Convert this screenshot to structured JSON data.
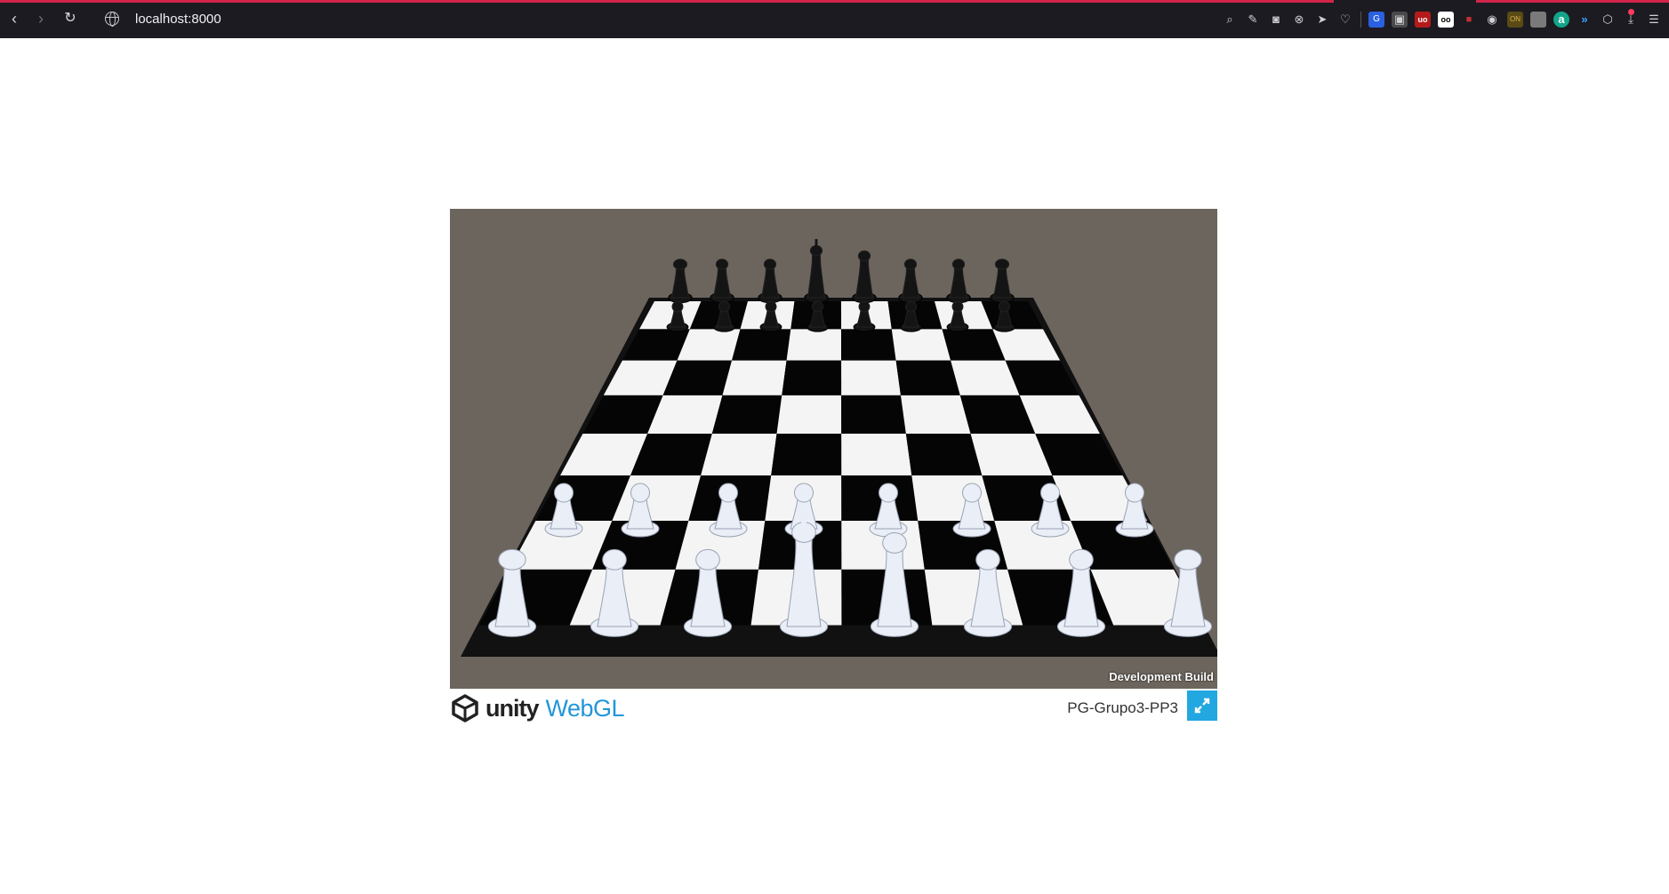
{
  "browser": {
    "url": "localhost:8000",
    "toolbar_icons": [
      "zoom-icon",
      "edit-icon",
      "camera-icon",
      "block-icon",
      "send-icon",
      "heart-icon",
      "translate-icon",
      "cube-icon",
      "ublock-icon",
      "glasses-icon",
      "video-icon",
      "eye-icon",
      "ext-icon",
      "square-icon",
      "amazon-icon",
      "wave-icon",
      "box-icon",
      "download-icon",
      "sidebar-icon"
    ]
  },
  "game": {
    "development_build": "Development Build",
    "product_title": "PG-Grupo3-PP3"
  },
  "logo": {
    "unity": "unity",
    "webgl": "WebGL"
  },
  "colors": {
    "canvas_bg": "#6c655d",
    "accent": "#22a7e0",
    "chrome_bg": "#1c1b22"
  }
}
